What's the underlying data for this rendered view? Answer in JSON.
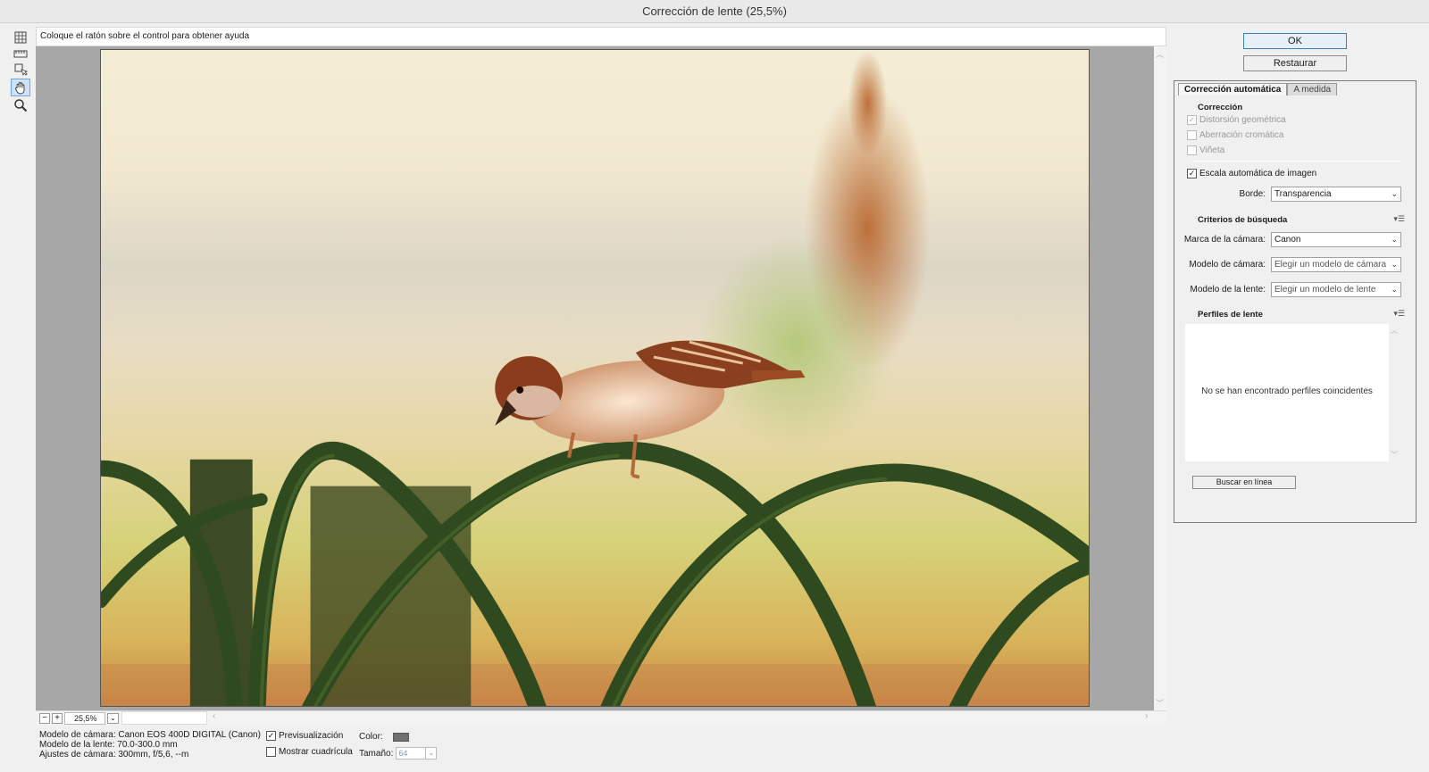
{
  "window": {
    "title": "Corrección de lente (25,5%)"
  },
  "help": {
    "text": "Coloque el ratón sobre el control para obtener ayuda"
  },
  "tools": [
    {
      "name": "remove-distortion-tool-icon"
    },
    {
      "name": "straighten-tool-icon"
    },
    {
      "name": "move-grid-tool-icon"
    },
    {
      "name": "hand-tool-icon",
      "active": true
    },
    {
      "name": "zoom-tool-icon"
    }
  ],
  "zoom": {
    "value": "25,5%",
    "minus": "−",
    "plus": "+",
    "dropdown": "⌄"
  },
  "camera_info": {
    "camera_model": "Modelo de cámara: Canon EOS 400D DIGITAL (Canon)",
    "lens_model": "Modelo de la lente: 70.0-300.0 mm",
    "camera_settings": "Ajustes de cámara: 300mm, f/5,6, --m"
  },
  "options": {
    "preview_label": "Previsualización",
    "preview_checked": true,
    "grid_label": "Mostrar cuadrícula",
    "grid_checked": false,
    "color_label": "Color:",
    "grid_color": "#707070",
    "size_label": "Tamaño:",
    "size_value": "64"
  },
  "buttons": {
    "ok": "OK",
    "reset": "Restaurar"
  },
  "tabs": {
    "auto": "Corrección automática",
    "custom": "A medida"
  },
  "correction": {
    "title": "Corrección",
    "geometric": {
      "label": "Distorsión geométrica",
      "checked": true,
      "disabled": true
    },
    "chromatic": {
      "label": "Aberración cromática",
      "checked": false,
      "disabled": true
    },
    "vignette": {
      "label": "Viñeta",
      "checked": false,
      "disabled": true
    },
    "autoscale": {
      "label": "Escala automática de imagen",
      "checked": true
    },
    "edge_label": "Borde:",
    "edge_value": "Transparencia"
  },
  "search": {
    "title": "Criterios de búsqueda",
    "make_label": "Marca de la cámara:",
    "make_value": "Canon",
    "model_label": "Modelo de cámara:",
    "model_placeholder": "Elegir un modelo de cámara",
    "lens_label": "Modelo de la lente:",
    "lens_placeholder": "Elegir un modelo de lente"
  },
  "profiles": {
    "title": "Perfiles de lente",
    "empty_message": "No se han encontrado perfiles coincidentes",
    "search_online": "Buscar en línea"
  },
  "photo": {
    "subject": "sparrow-on-fence"
  }
}
